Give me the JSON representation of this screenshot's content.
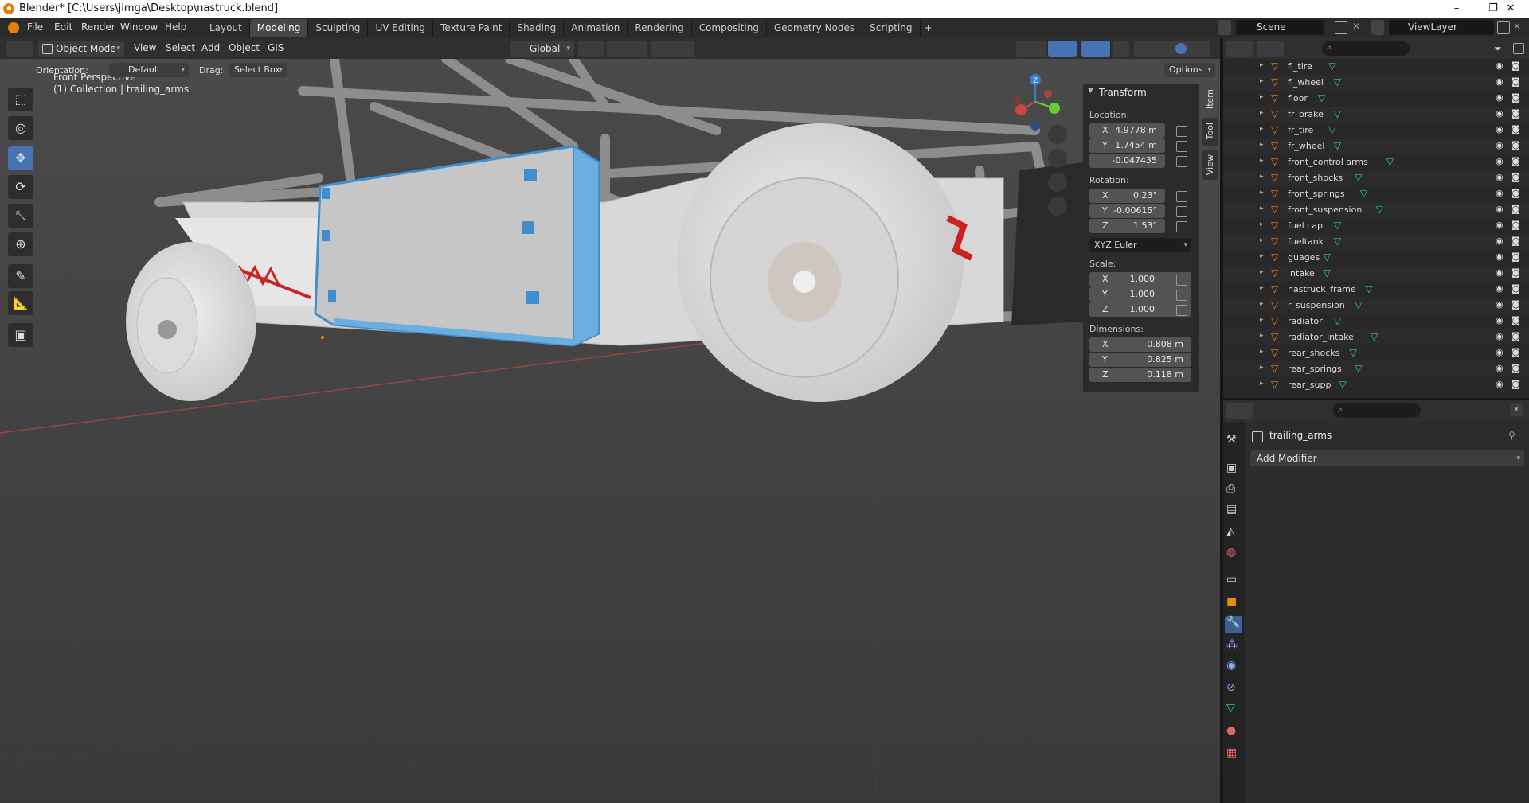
{
  "window": {
    "title": "Blender* [C:\\Users\\jimga\\Desktop\\nastruck.blend]",
    "controls": [
      "–",
      "❐",
      "✕"
    ]
  },
  "menubar": {
    "items": [
      "File",
      "Edit",
      "Render",
      "Window",
      "Help"
    ]
  },
  "workspace_tabs": [
    "Layout",
    "Modeling",
    "Sculpting",
    "UV Editing",
    "Texture Paint",
    "Shading",
    "Animation",
    "Rendering",
    "Compositing",
    "Geometry Nodes",
    "Scripting",
    "+"
  ],
  "active_tab": "Modeling",
  "scene": {
    "scene_name": "Scene",
    "view_layer": "ViewLayer"
  },
  "viewport_header": {
    "mode": "Object Mode",
    "menus": [
      "View",
      "Select",
      "Add",
      "Object",
      "GIS"
    ],
    "transform_orientation": "Global"
  },
  "tool_settings": {
    "orientation_label": "Orientation:",
    "orientation_value": "Default",
    "drag_label": "Drag:",
    "drag_value": "Select Box",
    "options_label": "Options"
  },
  "viewport": {
    "view_name": "Front Perspective",
    "collection_info": "(1) Collection | trailing_arms",
    "gizmo_axes": {
      "x": "X",
      "y": "Y",
      "z": "Z"
    },
    "colors": {
      "background": "#3e3e3e",
      "selected_outline": "#4a9fd6",
      "x_axis": "#c44",
      "y_axis": "#6c3",
      "z_axis": "#38c"
    }
  },
  "toolbar": {
    "tools": [
      "select-box",
      "cursor",
      "move",
      "rotate",
      "scale",
      "transform",
      "annotate",
      "measure",
      "add-cube"
    ],
    "active": "move"
  },
  "n_panel": {
    "section": "Transform",
    "location_label": "Location:",
    "location": [
      {
        "axis": "X",
        "value": "4.9778 m"
      },
      {
        "axis": "Y",
        "value": "1.7454 m"
      },
      {
        "axis": "",
        "value": "-0.047435"
      }
    ],
    "rotation_label": "Rotation:",
    "rotation": [
      {
        "axis": "X",
        "value": "0.23°"
      },
      {
        "axis": "Y",
        "value": "-0.00615°"
      },
      {
        "axis": "Z",
        "value": "1.53°"
      }
    ],
    "rotation_mode": "XYZ Euler",
    "scale_label": "Scale:",
    "scale": [
      {
        "axis": "X",
        "value": "1.000"
      },
      {
        "axis": "Y",
        "value": "1.000"
      },
      {
        "axis": "Z",
        "value": "1.000"
      }
    ],
    "dimensions_label": "Dimensions:",
    "dimensions": [
      {
        "axis": "X",
        "value": "0.808 m"
      },
      {
        "axis": "Y",
        "value": "0.825 m"
      },
      {
        "axis": "Z",
        "value": "0.118 m"
      }
    ],
    "side_tabs": [
      "Item",
      "Tool",
      "View"
    ]
  },
  "outliner": {
    "items": [
      "fl_tire",
      "fl_wheel",
      "floor",
      "fr_brake",
      "fr_tire",
      "fr_wheel",
      "front_control arms",
      "front_shocks",
      "front_springs",
      "front_suspension",
      "fuel cap",
      "fueltank",
      "guages",
      "intake",
      "nastruck_frame",
      "r_suspension",
      "radiator",
      "radiator_intake",
      "rear_shocks",
      "rear_springs",
      "rear_supp"
    ]
  },
  "properties": {
    "object_name": "trailing_arms",
    "add_modifier_label": "Add Modifier"
  }
}
